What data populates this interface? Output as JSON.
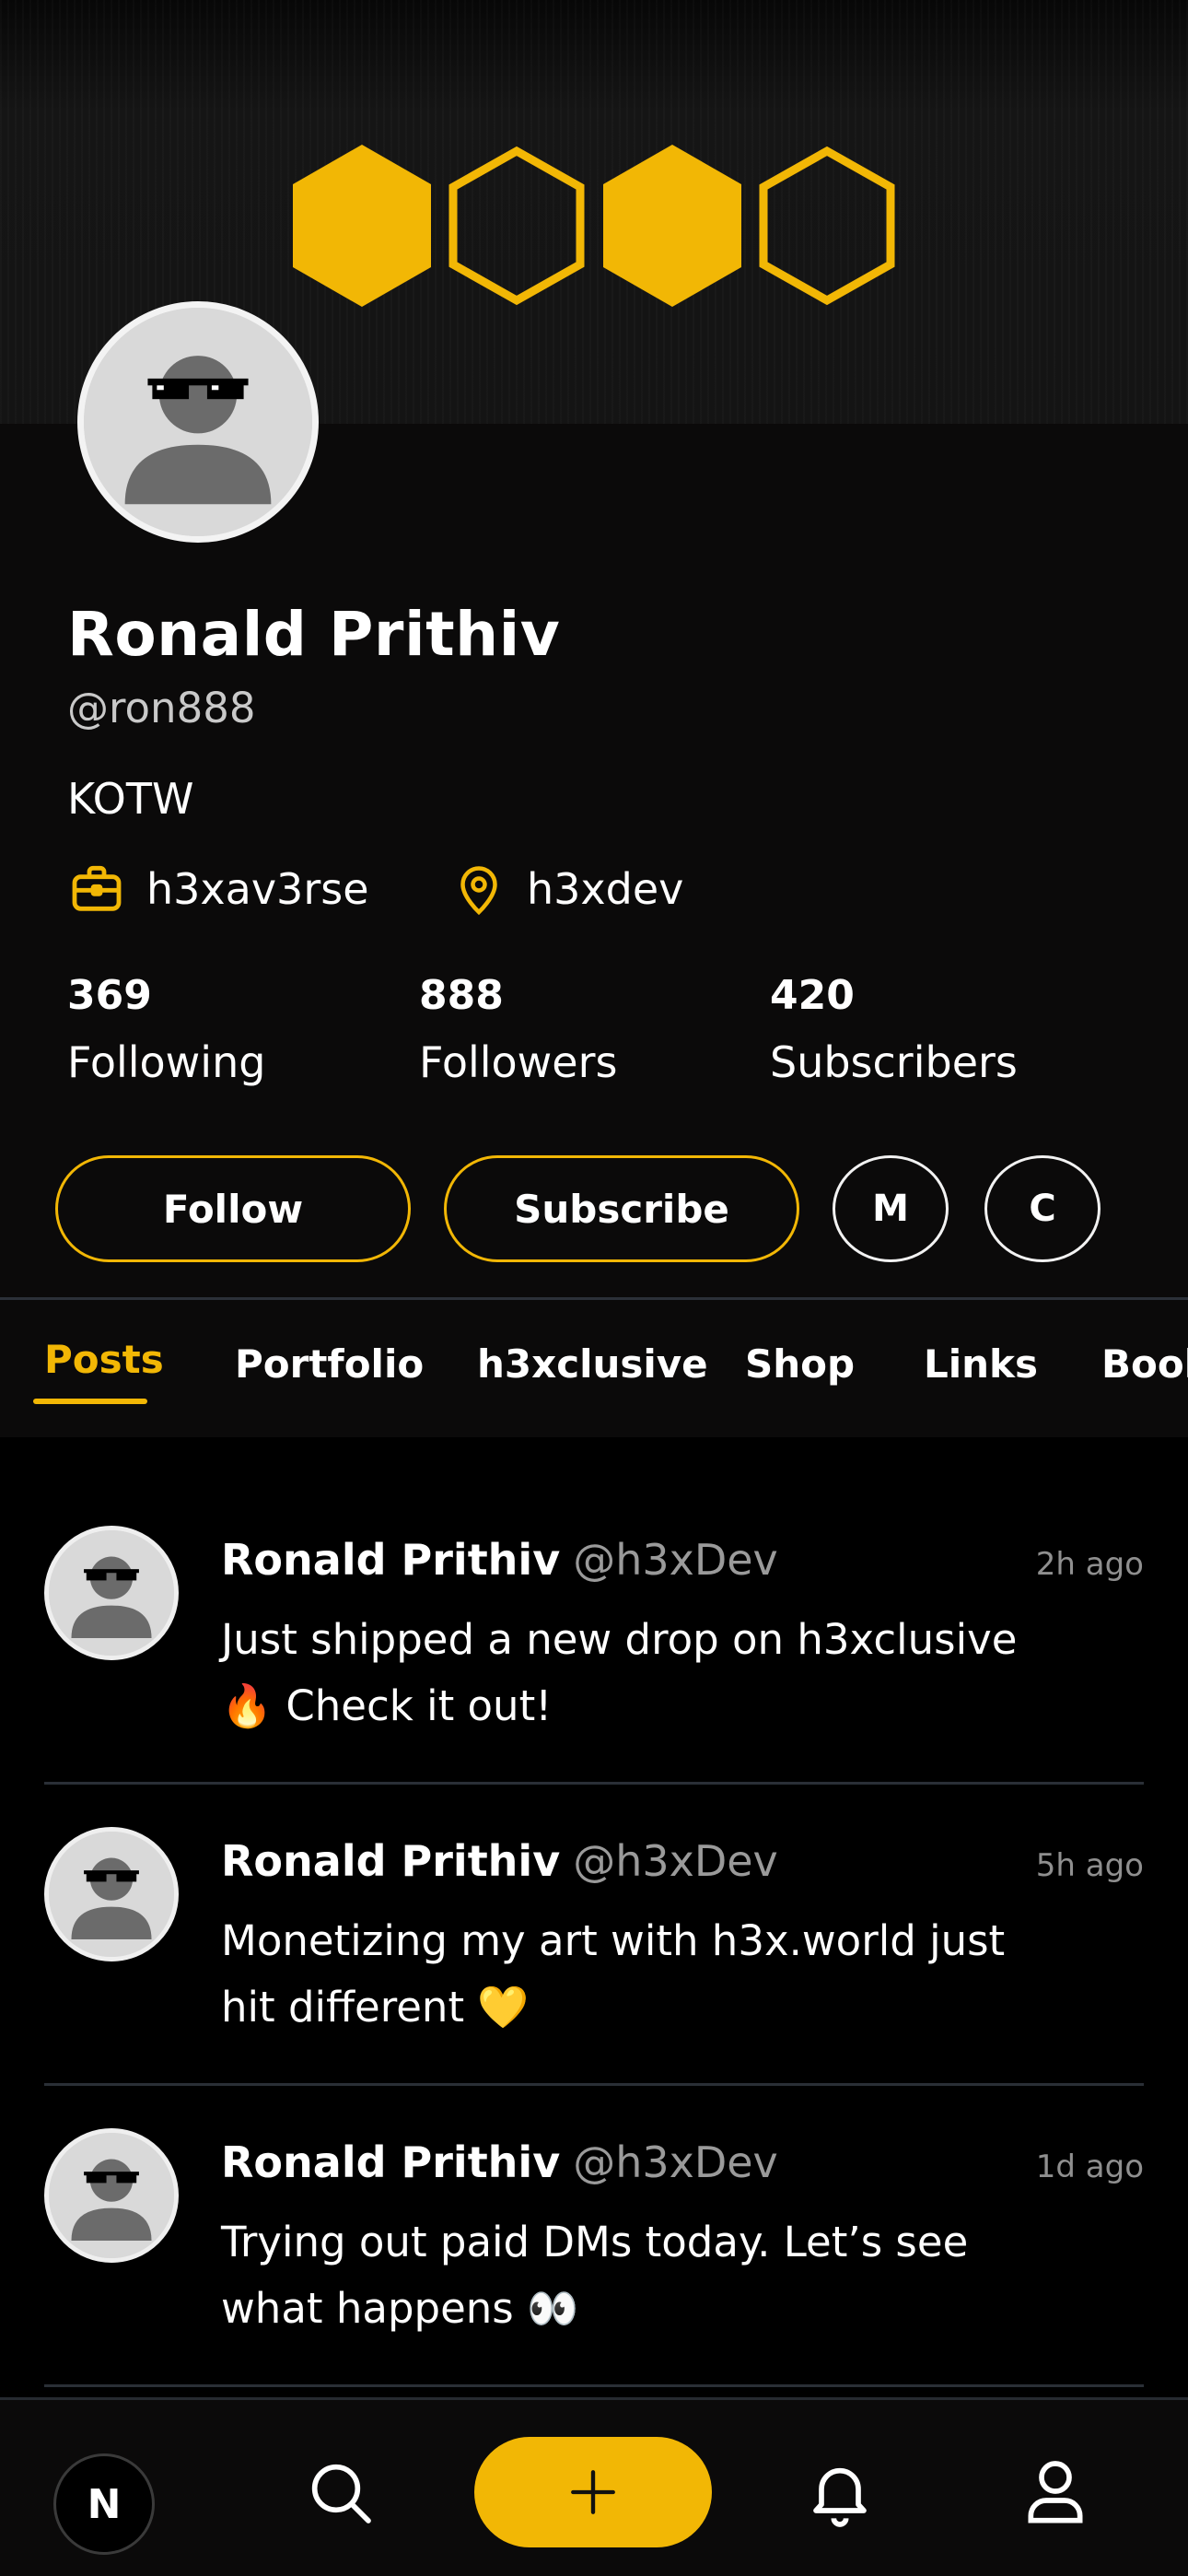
{
  "colors": {
    "accent": "#f2b705",
    "background": "#000000",
    "panel": "#0b0a0a"
  },
  "profile": {
    "name": "Ronald Prithiv",
    "handle": "@ron888",
    "bio": "KOTW",
    "work": {
      "icon": "briefcase-icon",
      "label": "h3xav3rse"
    },
    "location": {
      "icon": "location-pin-icon",
      "label": "h3xdev"
    },
    "stats": [
      {
        "value": "369",
        "label": "Following"
      },
      {
        "value": "888",
        "label": "Followers"
      },
      {
        "value": "420",
        "label": "Subscribers"
      }
    ]
  },
  "actions": {
    "follow": "Follow",
    "subscribe": "Subscribe",
    "m": "M",
    "c": "C"
  },
  "tabs": [
    "Posts",
    "Portfolio",
    "h3xclusive",
    "Shop",
    "Links",
    "Book"
  ],
  "active_tab": "Posts",
  "posts": [
    {
      "name": "Ronald Prithiv",
      "handle": "@h3xDev",
      "time": "2h ago",
      "text": "Just shipped a new drop on h3xclusive 🔥 Check it out!"
    },
    {
      "name": "Ronald Prithiv",
      "handle": "@h3xDev",
      "time": "5h ago",
      "text": "Monetizing my art with h3x.world just hit different 💛"
    },
    {
      "name": "Ronald Prithiv",
      "handle": "@h3xDev",
      "time": "1d ago",
      "text": "Trying out paid DMs today. Let’s see what happens 👀"
    }
  ],
  "nav": {
    "n_label": "N",
    "items": [
      "home-n-icon",
      "search-icon",
      "plus-icon",
      "bell-icon",
      "profile-icon"
    ]
  }
}
